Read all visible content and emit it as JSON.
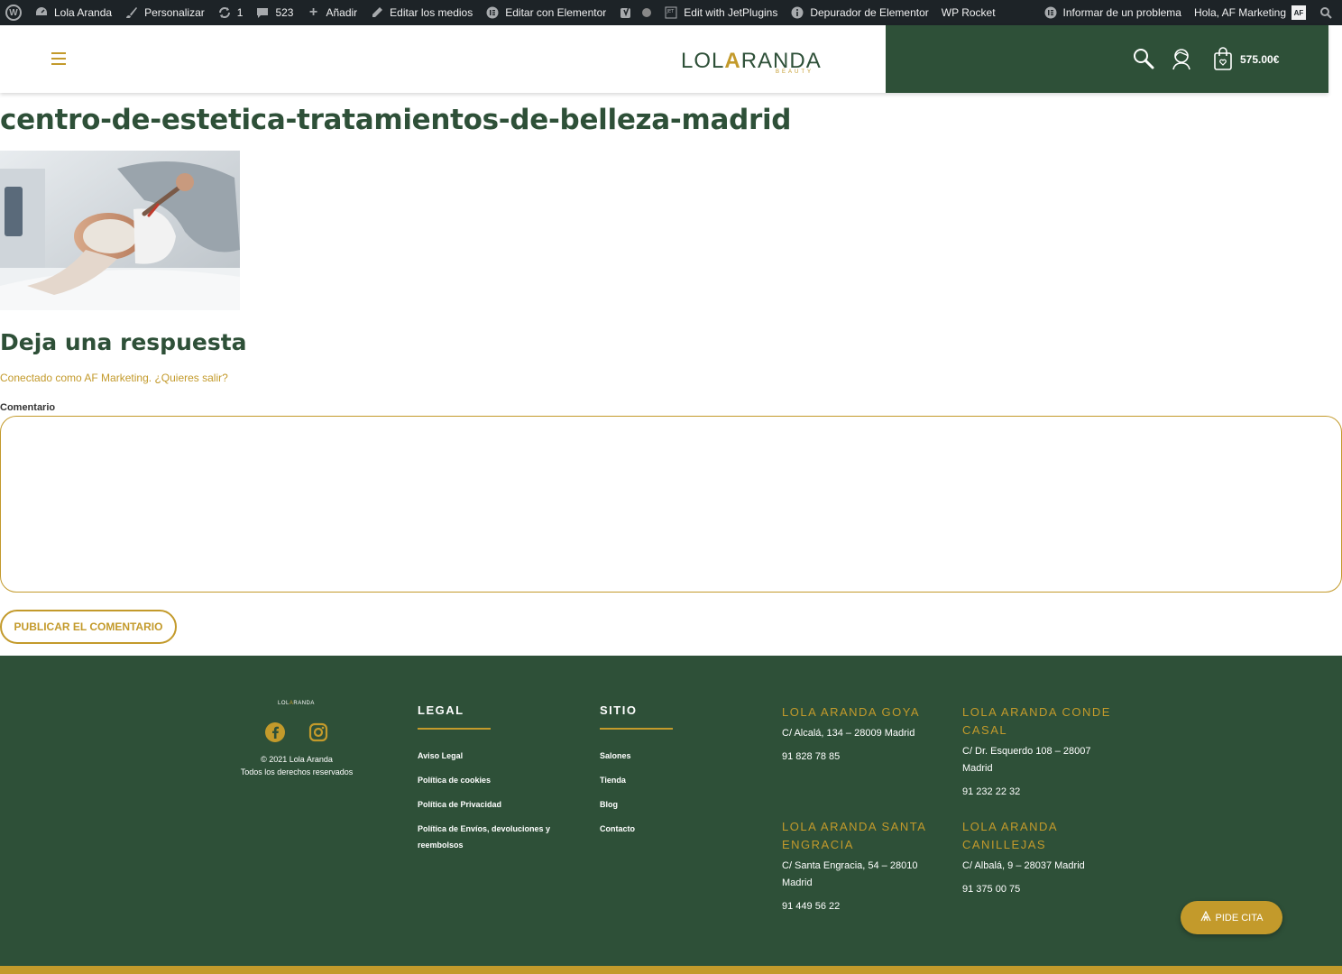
{
  "adminbar": {
    "site_name": "Lola Aranda",
    "customize": "Personalizar",
    "updates_count": "1",
    "comments_count": "523",
    "add_new": "Añadir",
    "edit_media": "Editar los medios",
    "edit_elementor": "Editar con Elementor",
    "edit_jetplugins": "Edit with JetPlugins",
    "elementor_debugger": "Depurador de Elementor",
    "wp_rocket": "WP Rocket",
    "report_problem": "Informar de un problema",
    "greeting": "Hola, AF Marketing",
    "avatar_initials": "AF"
  },
  "header": {
    "logo_left": "LOL",
    "logo_a": "A",
    "logo_right": "RANDA",
    "logo_sub": "BEAUTY",
    "cart_total": "575.00€"
  },
  "page": {
    "title": "centro-de-estetica-tratamientos-de-belleza-madrid"
  },
  "comments": {
    "reply_title": "Deja una respuesta",
    "logged_in_prefix": "Conectado como AF Marketing.",
    "logout_link": "¿Quieres salir?",
    "comment_label": "Comentario",
    "submit_label": "PUBLICAR EL COMENTARIO"
  },
  "footer": {
    "logo_left": "LOL",
    "logo_a": "A",
    "logo_right": "RANDA",
    "copyright_line1": "© 2021 Lola Aranda",
    "copyright_line2": "Todos los derechos reservados",
    "legal": {
      "heading": "LEGAL",
      "links": [
        "Aviso Legal",
        "Política de cookies",
        "Política de Privacidad",
        "Política de Envíos, devoluciones y reembolsos"
      ]
    },
    "sitio": {
      "heading": "SITIO",
      "links": [
        "Salones",
        "Tienda",
        "Blog",
        "Contacto"
      ]
    },
    "locations": [
      {
        "name": "LOLA ARANDA GOYA",
        "address": "C/ Alcalá, 134 – 28009 Madrid",
        "phone": "91 828 78 85"
      },
      {
        "name": "LOLA ARANDA CONDE CASAL",
        "address": "C/ Dr. Esquerdo 108 – 28007 Madrid",
        "phone": "91 232 22 32"
      },
      {
        "name": "LOLA ARANDA SANTA ENGRACIA",
        "address": "C/ Santa Engracia, 54 – 28010 Madrid",
        "phone": "91 449 56 22"
      },
      {
        "name": "LOLA ARANDA CANILLEJAS",
        "address": "C/ Albalá, 9 – 28037 Madrid",
        "phone": "91 375 00 75"
      }
    ]
  },
  "cta": {
    "label": "PIDE CITA"
  },
  "colors": {
    "brand_green": "#2e5038",
    "brand_gold": "#c39a2b",
    "adminbar": "#1d2327"
  }
}
